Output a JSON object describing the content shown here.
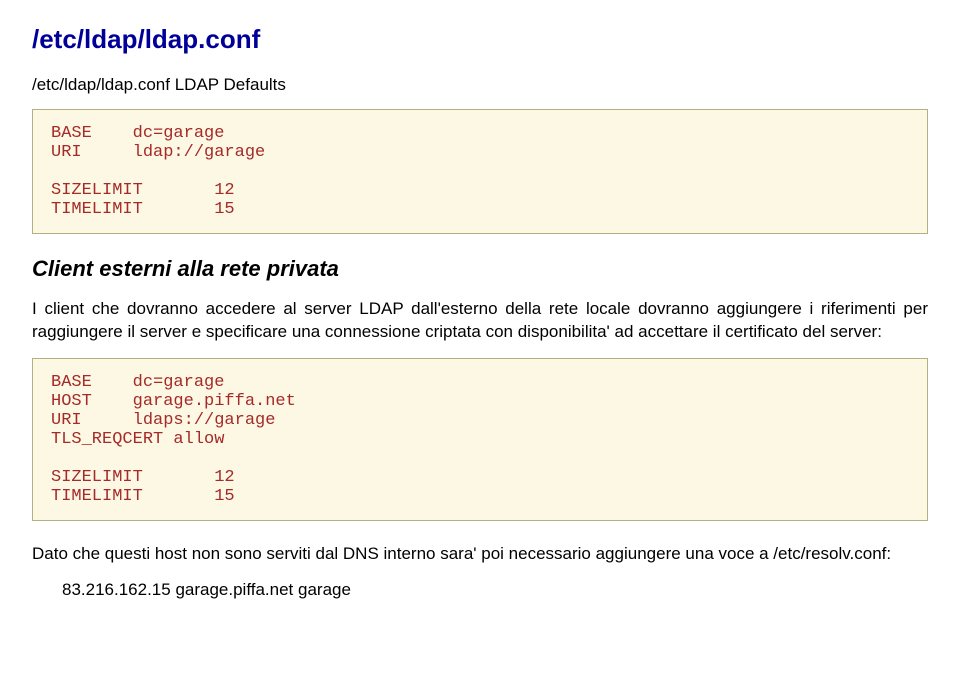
{
  "page_title": "/etc/ldap/ldap.conf",
  "subtitle": "/etc/ldap/ldap.conf LDAP Defaults",
  "code_block_1": "BASE    dc=garage\nURI     ldap://garage\n\nSIZELIMIT       12\nTIMELIMIT       15",
  "section_heading": "Client esterni alla rete privata",
  "paragraph_1": "I client che dovranno accedere al server LDAP dall'esterno della rete locale dovranno aggiungere i riferimenti per raggiungere il server e specificare una connessione criptata con disponibilita' ad accettare il certificato del server:",
  "code_block_2": "BASE    dc=garage\nHOST    garage.piffa.net\nURI     ldaps://garage\nTLS_REQCERT allow\n\nSIZELIMIT       12\nTIMELIMIT       15",
  "paragraph_2": "Dato che questi host non sono serviti dal DNS interno sara' poi necessario aggiungere una voce a /etc/resolv.conf:",
  "ip_line": "83.216.162.15 garage.piffa.net garage"
}
